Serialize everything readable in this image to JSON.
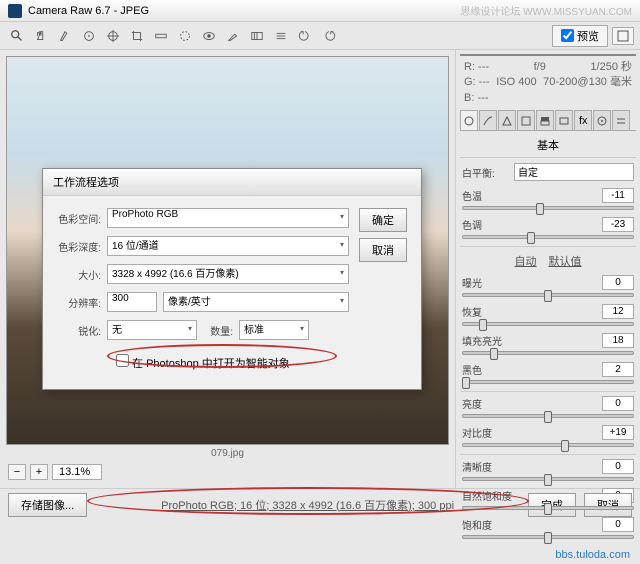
{
  "title": "Camera Raw 6.7 - JPEG",
  "watermark_top": "思缘设计论坛 WWW.MISSYUAN.COM",
  "preview_btn": "预览",
  "filename": "079.jpg",
  "zoom": "13.1%",
  "info": {
    "r": "R: ---",
    "g": "G: ---",
    "b": "B: ---",
    "f": "f/9",
    "shutter": "1/250 秒",
    "iso": "ISO 400",
    "lens": "70-200@130 毫米"
  },
  "panel_title": "基本",
  "wb_label": "白平衡:",
  "wb_value": "自定",
  "sliders": {
    "temp": {
      "label": "色温",
      "val": "-11",
      "pos": 45
    },
    "tint": {
      "label": "色调",
      "val": "-23",
      "pos": 40
    },
    "exposure": {
      "label": "曝光",
      "val": "0",
      "pos": 50
    },
    "recovery": {
      "label": "恢复",
      "val": "12",
      "pos": 12
    },
    "fill": {
      "label": "填充亮光",
      "val": "18",
      "pos": 18
    },
    "black": {
      "label": "黑色",
      "val": "2",
      "pos": 2
    },
    "bright": {
      "label": "亮度",
      "val": "0",
      "pos": 50
    },
    "contrast": {
      "label": "对比度",
      "val": "+19",
      "pos": 60
    },
    "clarity": {
      "label": "清晰度",
      "val": "0",
      "pos": 50
    },
    "vibrance": {
      "label": "自然饱和度",
      "val": "0",
      "pos": 50
    },
    "saturation": {
      "label": "饱和度",
      "val": "0",
      "pos": 50
    }
  },
  "auto_link": "自动",
  "default_link": "默认值",
  "url_wm": "bbs.tuloda.com",
  "save_btn": "存储图像...",
  "workflow": "ProPhoto RGB; 16 位; 3328 x 4992 (16.6 百万像素); 300 ppi",
  "done_btn": "完成",
  "cancel_btn": "取消",
  "dialog": {
    "title": "工作流程选项",
    "space_lbl": "色彩空间:",
    "space_val": "ProPhoto RGB",
    "depth_lbl": "色彩深度:",
    "depth_val": "16 位/通道",
    "size_lbl": "大小:",
    "size_val": "3328 x 4992 (16.6 百万像素)",
    "res_lbl": "分辨率:",
    "res_val": "300",
    "res_unit": "像素/英寸",
    "sharp_lbl": "锐化:",
    "sharp_val": "无",
    "amount_lbl": "数量:",
    "amount_val": "标准",
    "open_smart": "在 Photoshop 中打开为智能对象",
    "ok": "确定",
    "cancel": "取消"
  }
}
